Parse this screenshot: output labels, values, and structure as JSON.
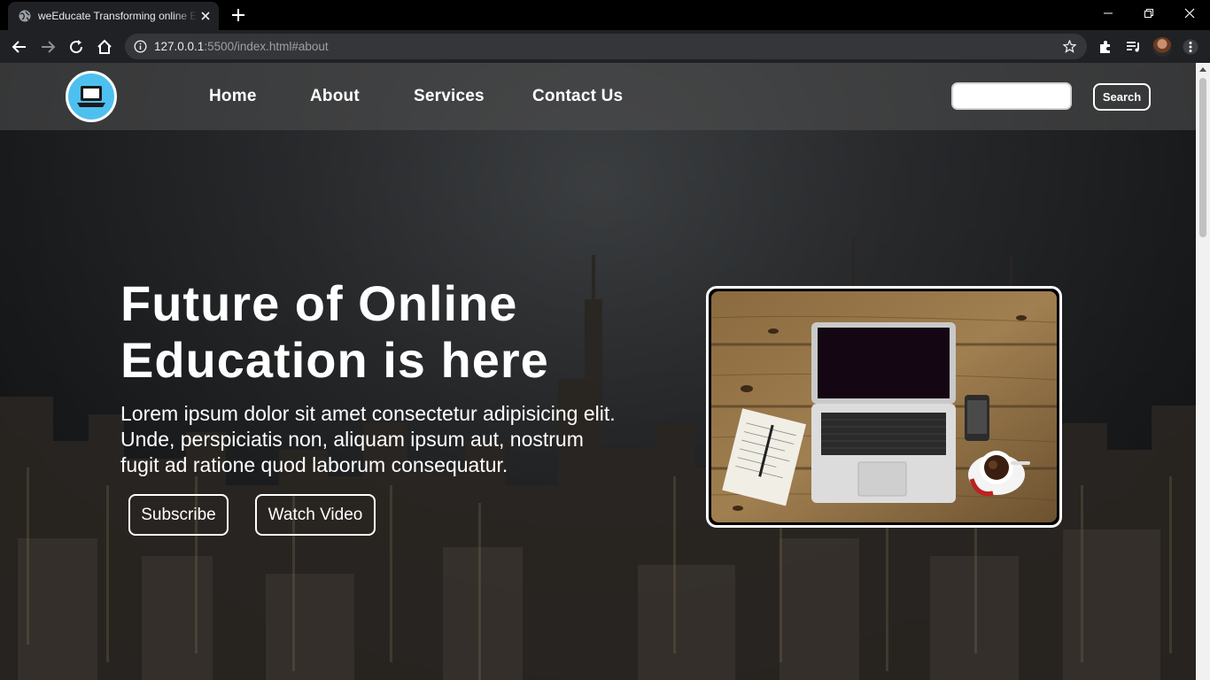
{
  "browser": {
    "tab_title": "weEducate Transforming online Education",
    "url_host": "127.0.0.1",
    "url_rest": ":5500/index.html#about",
    "icons": [
      "globe-icon",
      "close-icon",
      "plus-icon",
      "back-icon",
      "forward-icon",
      "reload-icon",
      "home-icon",
      "info-icon",
      "star-icon",
      "extensions-icon",
      "media-icon",
      "profile-avatar",
      "menu-icon",
      "minimize-icon",
      "maximize-icon",
      "window-close-icon"
    ]
  },
  "navbar": {
    "links": [
      "Home",
      "About",
      "Services",
      "Contact Us"
    ],
    "search_placeholder": "",
    "search_button": "Search"
  },
  "hero": {
    "title_line1": "Future of Online",
    "title_line2": "Education is here",
    "paragraph_line1": "Lorem ipsum dolor sit amet consectetur adipisicing elit.",
    "paragraph_line2": "Unde, perspiciatis non, aliquam ipsum aut, nostrum",
    "paragraph_line3": "fugit ad ratione quod laborum consequatur.",
    "subscribe_button": "Subscribe",
    "watch_button": "Watch Video"
  },
  "colors": {
    "logo_bg": "#4ec0f0",
    "chrome_bg": "#202124",
    "omnibox_bg": "#35363a"
  }
}
